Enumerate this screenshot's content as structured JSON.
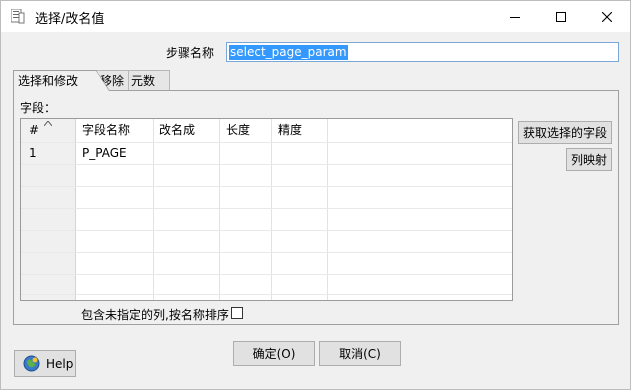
{
  "window": {
    "title": "选择/改名值"
  },
  "step": {
    "label": "步骤名称",
    "value": "select_page_param"
  },
  "tabs": [
    {
      "label": "选择和修改",
      "active": true
    },
    {
      "label": "移除",
      "active": false
    },
    {
      "label": "元数据",
      "active": false
    }
  ],
  "fields": {
    "label": "字段：",
    "columns": [
      "#",
      "字段名称",
      "改名成",
      "长度",
      "精度"
    ],
    "rows": [
      {
        "num": "1",
        "name": "P_PAGE",
        "rename": "",
        "length": "",
        "precision": ""
      }
    ]
  },
  "buttons": {
    "get_fields": "获取选择的字段",
    "map": "列映射",
    "ok": "确定(O)",
    "cancel": "取消(C)",
    "help": "Help"
  },
  "include_unspecified": {
    "label": "包含未指定的列,按名称排序",
    "checked": false
  },
  "colors": {
    "selection": "#3399ff",
    "dialog_bg": "#f0f0f0",
    "input_border": "#7aa7d6"
  }
}
